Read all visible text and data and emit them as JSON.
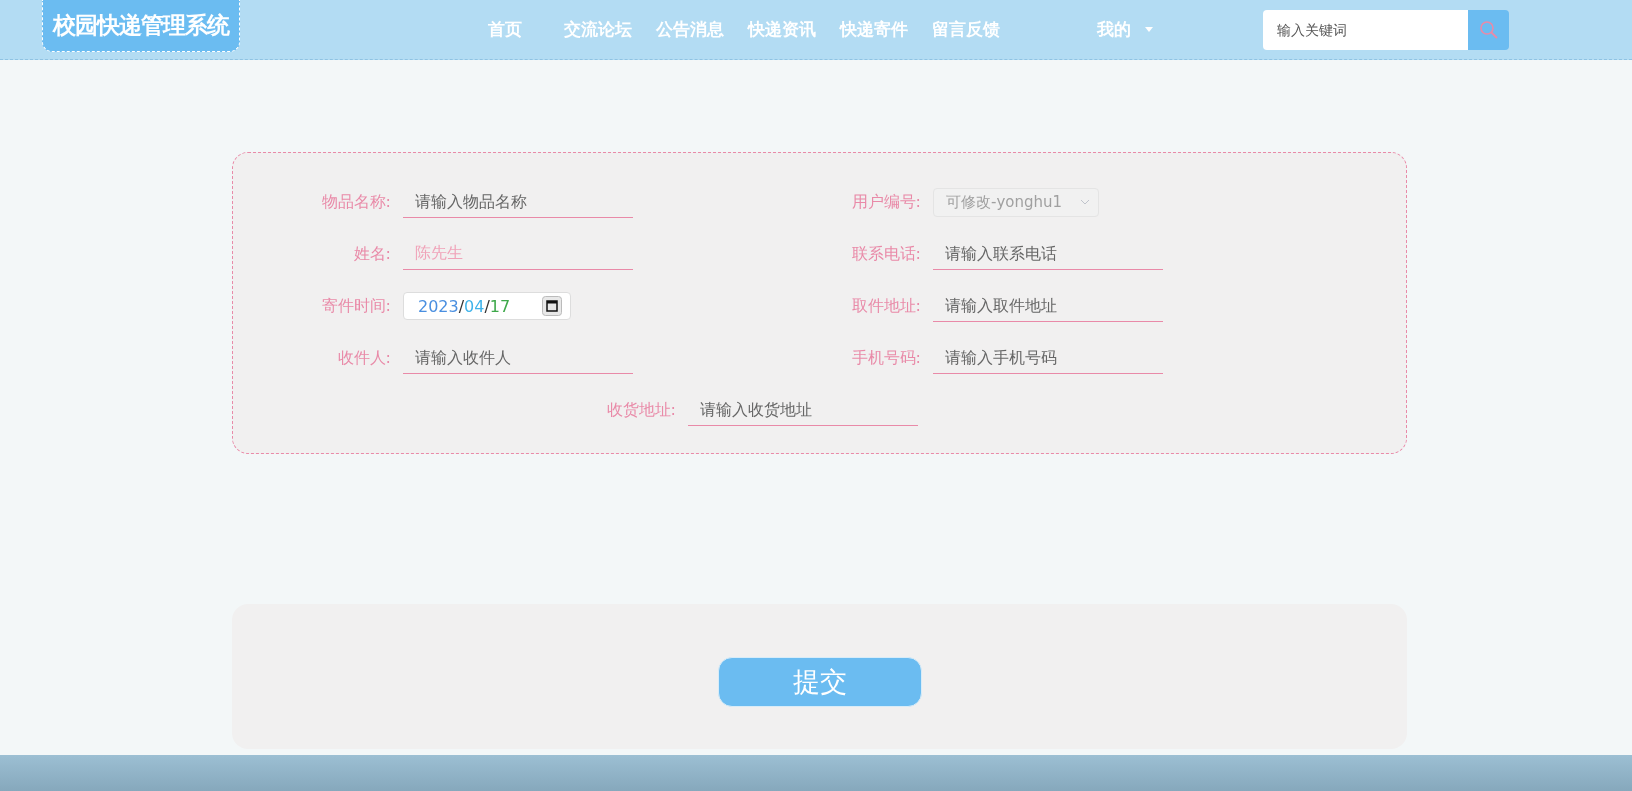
{
  "header": {
    "logo": "校园快递管理系统",
    "nav": [
      {
        "label": "首页",
        "selected": false
      },
      {
        "label": "交流论坛",
        "selected": false
      },
      {
        "label": "公告消息",
        "selected": false
      },
      {
        "label": "快递资讯",
        "selected": false
      },
      {
        "label": "快递寄件",
        "selected": false
      },
      {
        "label": "留言反馈",
        "selected": false
      }
    ],
    "user_menu": "我的",
    "search": {
      "placeholder": "输入关键词"
    }
  },
  "form": {
    "fields": [
      {
        "kind": "text",
        "label": "物品名称:",
        "placeholder": "请输入物品名称",
        "disabled": false
      },
      {
        "kind": "select",
        "label": "用户编号:",
        "value": "可修改-yonghu1",
        "disabled": true
      },
      {
        "kind": "text",
        "label": "姓名:",
        "value": "陈先生",
        "disabled": true
      },
      {
        "kind": "text",
        "label": "联系电话:",
        "placeholder": "请输入联系电话",
        "disabled": false
      },
      {
        "kind": "date",
        "label": "寄件时间:",
        "parts": [
          {
            "text": "2023",
            "color": "#4a8fe0"
          },
          {
            "text": "/",
            "color": "#333333"
          },
          {
            "text": "04",
            "color": "#3fb3ea"
          },
          {
            "text": "/",
            "color": "#333333"
          },
          {
            "text": "17",
            "color": "#3ea84a"
          }
        ]
      },
      {
        "kind": "text",
        "label": "取件地址:",
        "placeholder": "请输入取件地址",
        "disabled": false
      },
      {
        "kind": "text",
        "label": "收件人:",
        "placeholder": "请输入收件人",
        "disabled": false
      },
      {
        "kind": "text",
        "label": "手机号码:",
        "placeholder": "请输入手机号码",
        "disabled": false
      }
    ],
    "wide_field": {
      "label": "收货地址:",
      "placeholder": "请输入收货地址",
      "disabled": false
    }
  },
  "submit": "提交"
}
